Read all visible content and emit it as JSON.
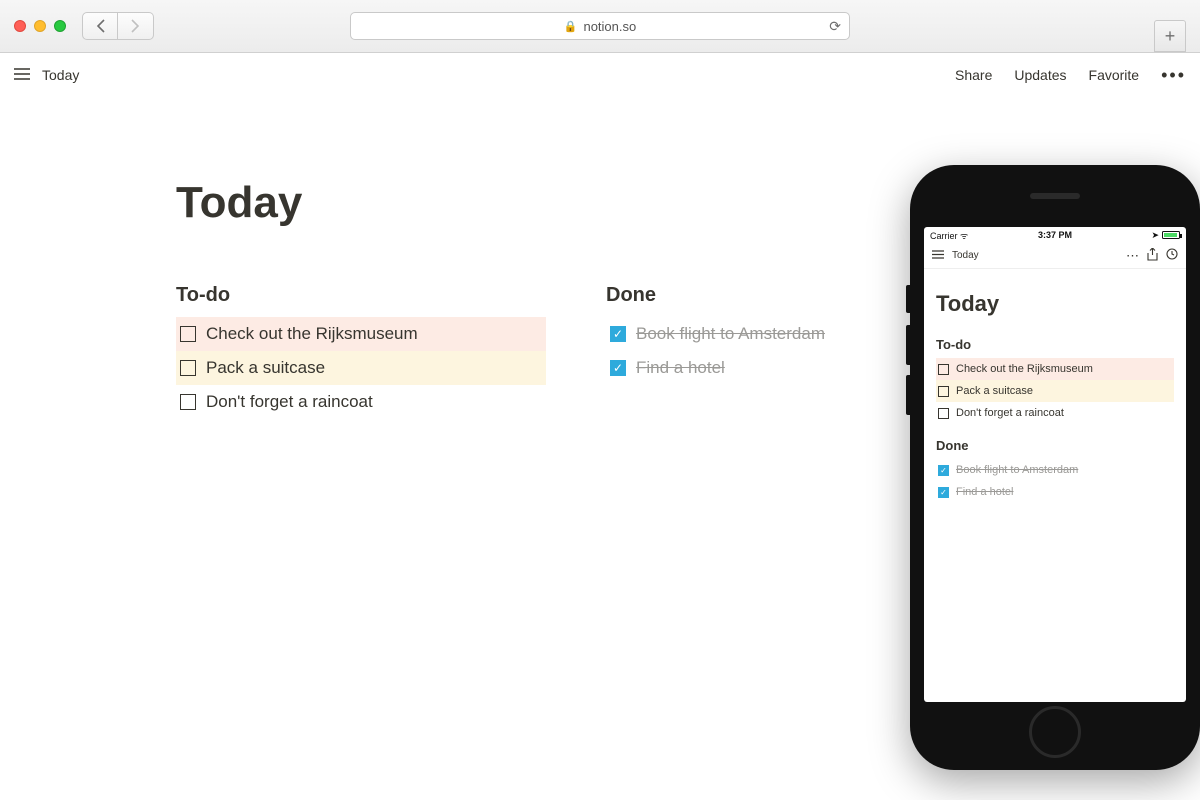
{
  "browser": {
    "url_host": "notion.so"
  },
  "toolbar": {
    "breadcrumb": "Today",
    "share": "Share",
    "updates": "Updates",
    "favorite": "Favorite"
  },
  "page": {
    "title": "Today",
    "todo_heading": "To-do",
    "done_heading": "Done",
    "todo": [
      "Check out the Rijksmuseum",
      "Pack a suitcase",
      "Don't forget a raincoat"
    ],
    "done": [
      "Book flight to Amsterdam",
      "Find a hotel"
    ]
  },
  "phone": {
    "status": {
      "carrier": "Carrier",
      "time": "3:37 PM"
    },
    "breadcrumb": "Today",
    "title": "Today",
    "todo_heading": "To-do",
    "done_heading": "Done",
    "todo": [
      "Check out the Rijksmuseum",
      "Pack a suitcase",
      "Don't forget a raincoat"
    ],
    "done": [
      "Book flight to Amsterdam",
      "Find a hotel"
    ]
  }
}
